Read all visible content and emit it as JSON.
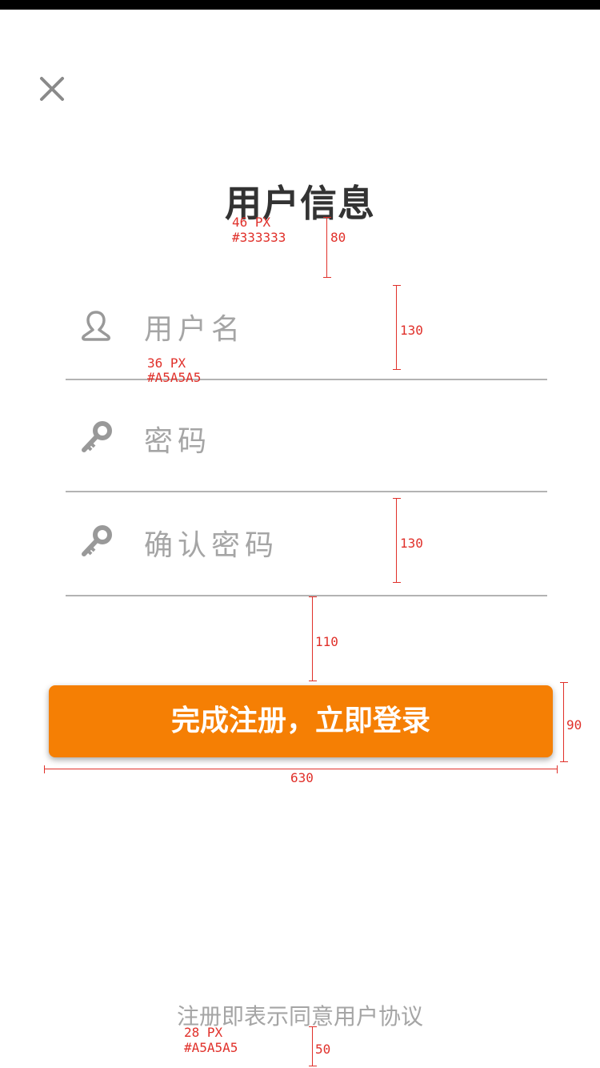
{
  "title": "用户信息",
  "fields": {
    "username_placeholder": "用户名",
    "password_placeholder": "密码",
    "confirm_placeholder": "确认密码"
  },
  "submit_label": "完成注册，立即登录",
  "agreement_text": "注册即表示同意用户协议",
  "annotations": {
    "title_size": "46 PX",
    "title_color": "#333333",
    "gap_title": "80",
    "field_height_1": "130",
    "field_size": "36 PX",
    "field_color": "#A5A5A5",
    "field_height_2": "130",
    "gap_button": "110",
    "button_height": "90",
    "button_width": "630",
    "agree_size": "28 PX",
    "agree_color": "#A5A5A5",
    "bottom_gap": "50"
  },
  "colors": {
    "accent": "#f57f04",
    "title": "#333333",
    "placeholder": "#a5a5a5"
  },
  "icons": {
    "close": "close-icon",
    "user": "user-icon",
    "key": "key-icon"
  }
}
